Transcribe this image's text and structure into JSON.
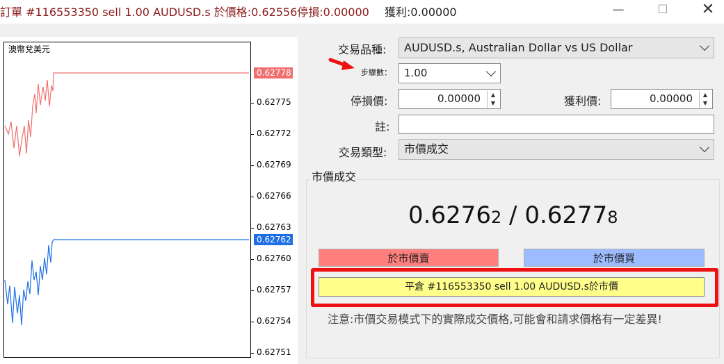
{
  "window": {
    "title": "訂單 #116553350 sell 1.00 AUDUSD.s 於價格:0.62556停損:0.00000",
    "profit": "獲利:0.00000",
    "min_glyph": "—",
    "max_glyph": "☐",
    "close_glyph": "✕"
  },
  "chart": {
    "title": "澳幣兌美元",
    "ticks": [
      "0.62775",
      "0.62772",
      "0.62769",
      "0.62766",
      "0.62763",
      "0.62760",
      "0.62757",
      "0.62754",
      "0.62751"
    ],
    "ask_marker": "0.62778",
    "bid_marker": "0.62762",
    "ask_color": "#f07070",
    "bid_color": "#1e6fe6"
  },
  "form": {
    "symbol_label": "交易品種:",
    "symbol_value": "AUDUSD.s, Australian Dollar vs US Dollar",
    "volume_label": "步驟數：",
    "volume_value": "1.00",
    "sl_label": "停損價:",
    "sl_value": "0.00000",
    "tp_label": "獲利價:",
    "tp_value": "0.00000",
    "comment_label": "註:",
    "comment_value": "",
    "type_label": "交易類型:",
    "type_value": "市價成交"
  },
  "market": {
    "group_title": "市價成交",
    "bid_main": "0.6276",
    "bid_small": "2",
    "separator": " / ",
    "ask_main": "0.6277",
    "ask_small": "8",
    "sell_label": "於市價賣",
    "buy_label": "於市價買",
    "close_label": "平倉 #116553350 sell 1.00 AUDUSD.s於市價",
    "note": "注意:市價交易模式下的實際成交價格,可能會和請求價格有一定差異!"
  },
  "colors": {
    "sell": "#ff7f7f",
    "buy": "#9dbbff",
    "close": "#ffff8a",
    "highlight": "#ee1111"
  }
}
